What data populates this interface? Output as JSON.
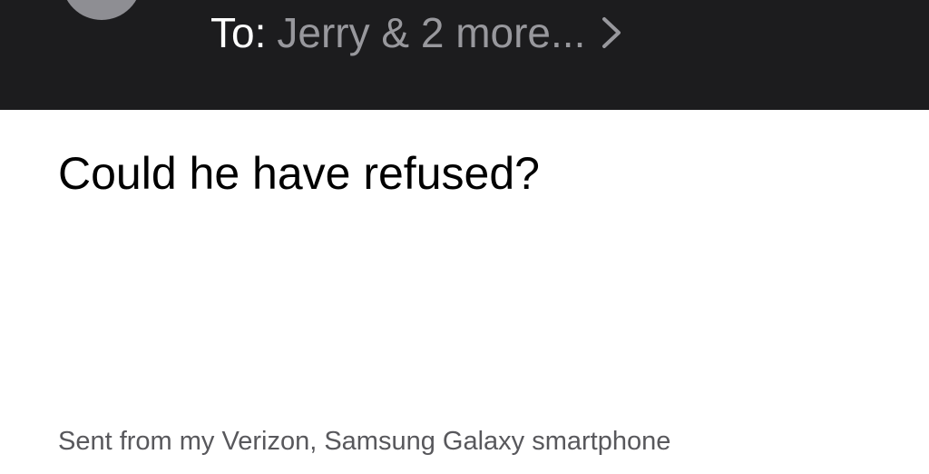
{
  "header": {
    "to_label": "To:",
    "recipients": "Jerry & 2 more...",
    "chevron_icon": "chevron-right-icon",
    "background_color": "#1c1c1e"
  },
  "message": {
    "body": "Could he have refused?",
    "signature": "Sent from my Verizon, Samsung Galaxy smartphone"
  }
}
